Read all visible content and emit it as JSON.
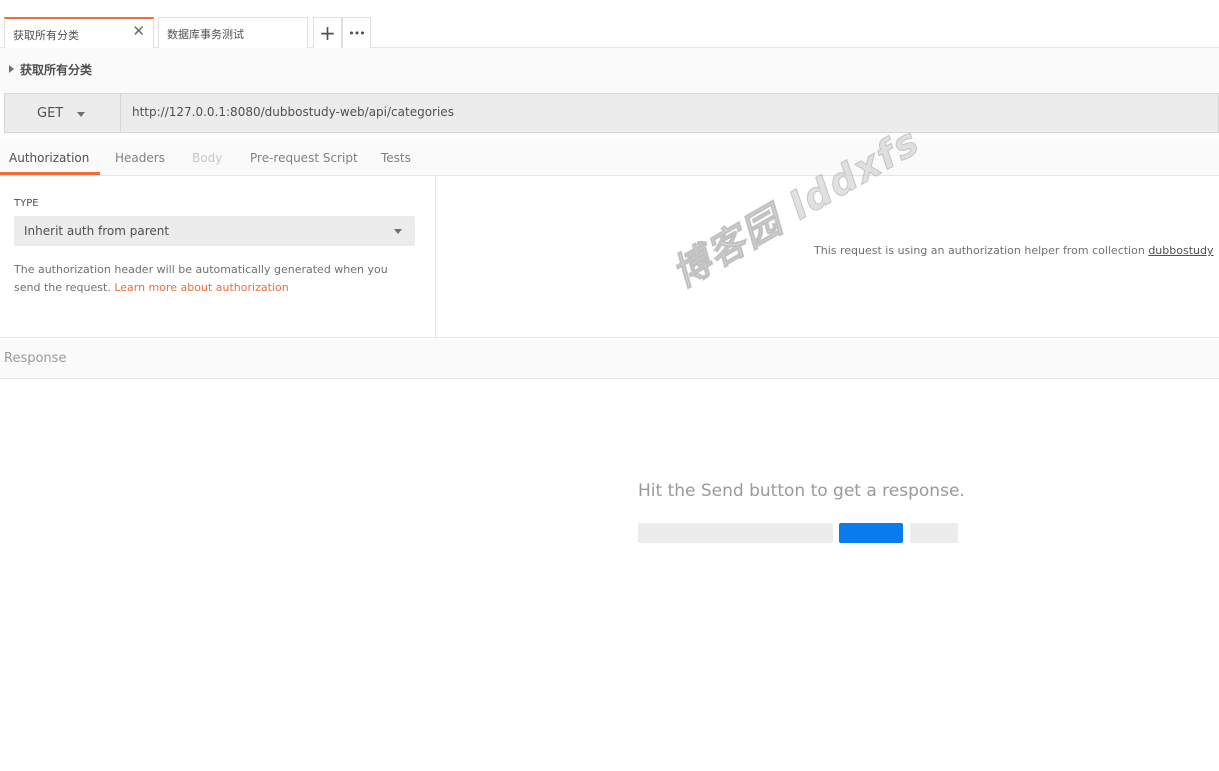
{
  "tabs": [
    {
      "label": "获取所有分类",
      "active": true
    },
    {
      "label": "数据库事务测试",
      "active": false
    }
  ],
  "tab_actions": {
    "add": "+",
    "more": "•••"
  },
  "request": {
    "name": "获取所有分类",
    "method": "GET",
    "url": "http://127.0.0.1:8080/dubbostudy-web/api/categories"
  },
  "subtabs": [
    {
      "label": "Authorization",
      "state": "active"
    },
    {
      "label": "Headers",
      "state": "normal"
    },
    {
      "label": "Body",
      "state": "disabled"
    },
    {
      "label": "Pre-request Script",
      "state": "normal"
    },
    {
      "label": "Tests",
      "state": "normal"
    }
  ],
  "auth": {
    "type_label": "TYPE",
    "type_value": "Inherit auth from parent",
    "description": "The authorization header will be automatically generated when you send the request.",
    "learn_more": "Learn more about authorization",
    "helper_text": "This request is using an authorization helper from collection",
    "collection_name": "dubbostudy"
  },
  "watermark": "博客园 lddxfs",
  "response": {
    "title": "Response",
    "hint": "Hit the Send button to get a response."
  },
  "colors": {
    "accent": "#f26b3a",
    "send_blue": "#097bed"
  }
}
